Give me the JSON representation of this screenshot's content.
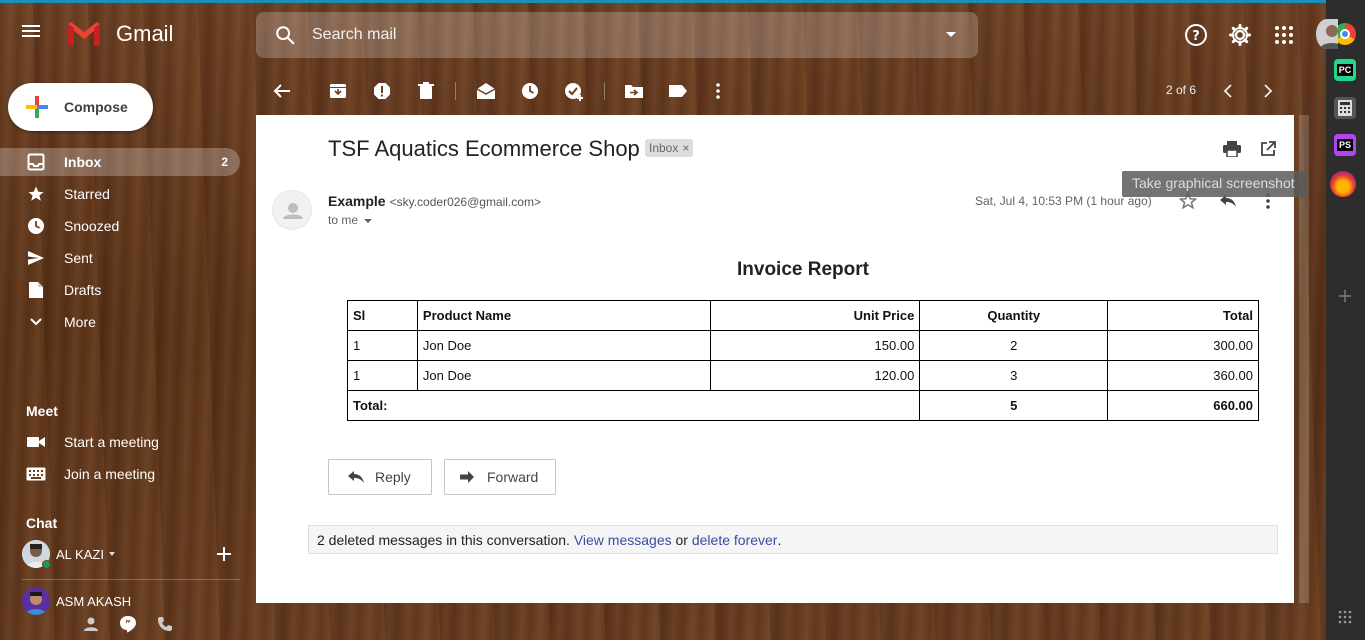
{
  "app": {
    "name": "Gmail"
  },
  "search": {
    "placeholder": "Search mail"
  },
  "compose": {
    "label": "Compose"
  },
  "nav": {
    "items": [
      {
        "label": "Inbox",
        "count": "2"
      },
      {
        "label": "Starred"
      },
      {
        "label": "Snoozed"
      },
      {
        "label": "Sent"
      },
      {
        "label": "Drafts"
      },
      {
        "label": "More"
      }
    ]
  },
  "meet": {
    "title": "Meet",
    "items": [
      {
        "label": "Start a meeting"
      },
      {
        "label": "Join a meeting"
      }
    ]
  },
  "chat": {
    "title": "Chat",
    "users": [
      {
        "name": "AL KAZI"
      },
      {
        "name": "ASM AKASH"
      }
    ]
  },
  "toolbar": {
    "pager": "2 of 6"
  },
  "message": {
    "subject": "TSF Aquatics Ecommerce Shop",
    "label": "Inbox",
    "label_close": "×",
    "sender_name": "Example",
    "sender_email": "<sky.coder026@gmail.com>",
    "to": "to me",
    "date": "Sat, Jul 4, 10:53 PM (1 hour ago)"
  },
  "invoice": {
    "title": "Invoice Report",
    "headers": [
      "Sl",
      "Product Name",
      "Unit Price",
      "Quantity",
      "Total"
    ],
    "rows": [
      [
        "1",
        "Jon Doe",
        "150.00",
        "2",
        "300.00"
      ],
      [
        "1",
        "Jon Doe",
        "120.00",
        "3",
        "360.00"
      ]
    ],
    "total_label": "Total:",
    "total_quantity": "5",
    "total_amount": "660.00"
  },
  "actions": {
    "reply": "Reply",
    "forward": "Forward"
  },
  "deleted": {
    "text": "2 deleted messages in this conversation.",
    "view_link": "View messages",
    "or": "or",
    "delete_link": "delete forever",
    "period": "."
  },
  "tooltip": {
    "text": "Take graphical screenshot"
  },
  "right_panel": {
    "apps": [
      {
        "abbr": "PC"
      },
      {
        "abbr": "PS"
      }
    ]
  },
  "colors": {
    "gmail_red": "#ea4335",
    "link": "#3d4ba5",
    "card_bg": "#ffffff"
  }
}
